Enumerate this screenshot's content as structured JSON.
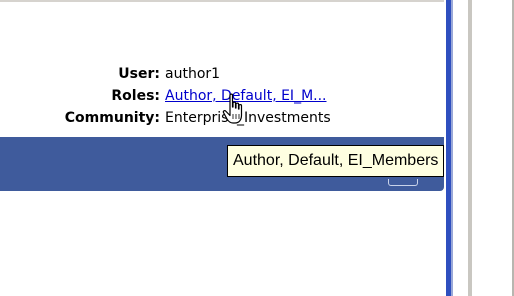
{
  "user_info": {
    "user_label": "User:",
    "user_value": "author1",
    "roles_label": "Roles:",
    "roles_value": "Author, Default, EI_M...",
    "community_label": "Community:",
    "community_value": "Enterprise_Investments"
  },
  "tooltip": {
    "text": "Author, Default, EI_Members"
  },
  "colors": {
    "header_bar": "#3f5b9c",
    "link": "#0000cc",
    "tooltip_bg": "#ffffe1",
    "divider_blue": "#2e4fbf"
  },
  "icons": {
    "cursor": "hand-pointer-icon"
  }
}
